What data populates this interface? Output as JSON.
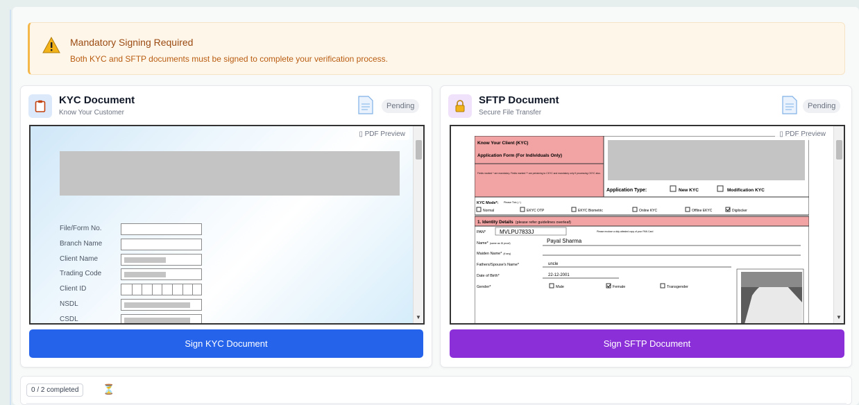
{
  "alert": {
    "title": "Mandatory Signing Required",
    "message": "Both KYC and SFTP documents must be signed to complete your verification process."
  },
  "cards": {
    "kyc": {
      "title": "KYC Document",
      "subtitle": "Know Your Customer",
      "status": "Pending",
      "preview_label": "PDF Preview",
      "sign_label": "Sign KYC Document",
      "fields": [
        "File/Form No.",
        "Branch Name",
        "Client Name",
        "Trading Code",
        "Client ID",
        "NSDL",
        "CSDL"
      ]
    },
    "sftp": {
      "title": "SFTP Document",
      "subtitle": "Secure File Transfer",
      "status": "Pending",
      "preview_label": "PDF Preview",
      "sign_label": "Sign SFTP Document"
    }
  },
  "kyc_form": {
    "header1": "Know Your Client (KYC)",
    "header2": "Application Form (For Individuals Only)",
    "note": "Fields marked * are mandatory. Fields marked ** are pertaining to CKYC and mandatory only if processing CKYC also.",
    "app_type_label": "Application Type:",
    "app_types": [
      "New KYC",
      "Modification KYC"
    ],
    "mode_label": "KYC Mode*:",
    "mode_hint": "Please Tick (✓)",
    "modes": [
      "Normal",
      "EKYC OTP",
      "EKYC Biometric",
      "Online KYC",
      "Offline EKYC",
      "Digilocker"
    ],
    "section": "1. Identity Details",
    "section_hint": "(please refer guidelines overleaf)",
    "pan_label": "PAN*",
    "pan_value": "MVLPU7833J",
    "pan_hint": "Please enclose a duly attested copy of your PAN Card",
    "name_label": "Name*",
    "name_hint": "(same as ID proof)",
    "name_value": "Payal Sharma",
    "maiden_label": "Maiden Name*",
    "maiden_hint": "(if any)",
    "father_label": "Fathers/Spouse's Name*",
    "father_value": "uncle",
    "dob_label": "Date of Birth*",
    "dob_value": "22-12-2001",
    "gender_label": "Gender*",
    "genders": [
      "Male",
      "Female",
      "Transgender"
    ]
  },
  "progress": {
    "label": "0 / 2 completed",
    "completed": 0,
    "total": 2
  },
  "colors": {
    "kyc_button": "#2563eb",
    "sftp_button": "#8b30d9",
    "alert_accent": "#f4b74a",
    "form_header": "#f2a4a4"
  }
}
